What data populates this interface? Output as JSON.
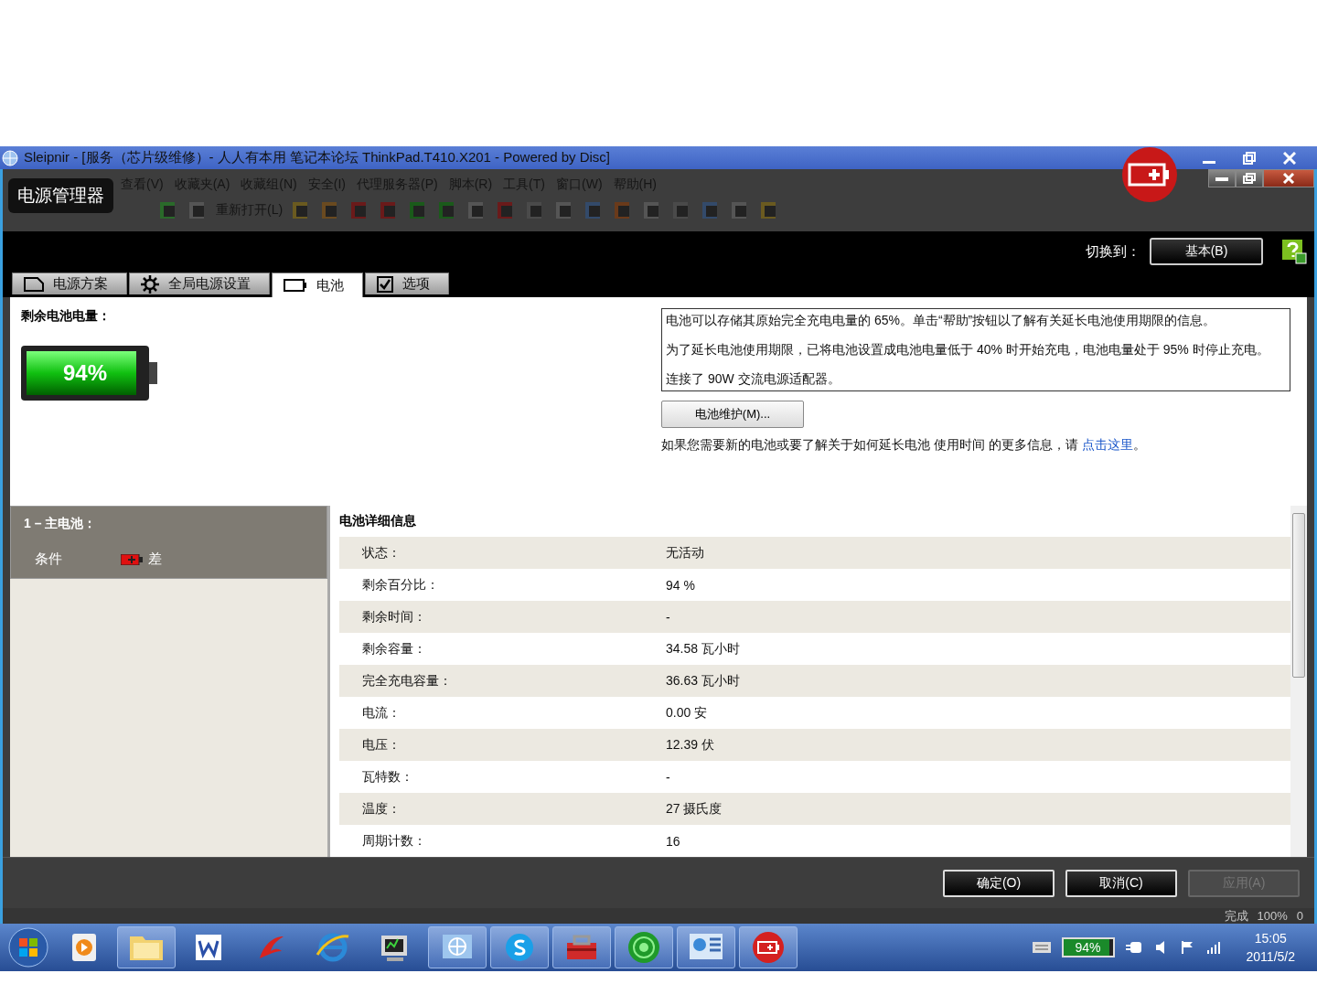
{
  "browser": {
    "title": "Sleipnir - [服务（芯片级维修）- 人人有本用 笔记本论坛 ThinkPad.T410.X201 - Powered by Disc]",
    "menu": [
      "查看(V)",
      "收藏夹(A)",
      "收藏组(N)",
      "安全(I)",
      "代理服务器(P)",
      "脚本(R)",
      "工具(T)",
      "窗口(W)",
      "帮助(H)"
    ],
    "reopen": "重新打开(L)",
    "status": {
      "text": "完成",
      "zoom": "100%",
      "errors": "0"
    }
  },
  "dialog": {
    "title": "电源管理器",
    "switch_label": "切换到：",
    "mode_button": "基本(B)",
    "tabs": [
      {
        "label": "电源方案",
        "kind": "page",
        "selected": false
      },
      {
        "label": "全局电源设置",
        "kind": "gear",
        "selected": false
      },
      {
        "label": "电池",
        "kind": "battery",
        "selected": true
      },
      {
        "label": "选项",
        "kind": "check",
        "selected": false
      }
    ],
    "remaining_label": "剩余电池电量：",
    "battery": {
      "text": "94%",
      "level": 0.94
    },
    "info": [
      "电池可以存储其原始完全充电电量的 65%。单击“帮助”按钮以了解有关延长电池使用期限的信息。",
      "为了延长电池使用期限，已将电池设置成电池电量低于 40% 时开始充电，电池电量处于 95% 时停止充电。",
      "连接了 90W 交流电源适配器。"
    ],
    "maintenance_button": "电池维护(M)...",
    "more_info": {
      "text": "如果您需要新的电池或要了解关于如何延长电池 使用时间 的更多信息，请 ",
      "link": "点击这里",
      "end": "。"
    },
    "battery_list": {
      "header": "1 – 主电池：",
      "condition_label": "条件",
      "condition_value": "差"
    },
    "details": {
      "title": "电池详细信息",
      "rows": [
        {
          "label": "状态：",
          "value": "无活动"
        },
        {
          "label": "剩余百分比：",
          "value": "94 %"
        },
        {
          "label": "剩余时间：",
          "value": "-"
        },
        {
          "label": "剩余容量：",
          "value": "34.58 瓦小时"
        },
        {
          "label": "完全充电容量：",
          "value": "36.63 瓦小时"
        },
        {
          "label": "电流：",
          "value": "0.00 安"
        },
        {
          "label": "电压：",
          "value": "12.39 伏"
        },
        {
          "label": "瓦特数：",
          "value": "-"
        },
        {
          "label": "温度：",
          "value": "27 摄氏度"
        },
        {
          "label": "周期计数：",
          "value": "16"
        }
      ]
    },
    "buttons": [
      {
        "label": "确定(O)",
        "disabled": false
      },
      {
        "label": "取消(C)",
        "disabled": false
      },
      {
        "label": "应用(A)",
        "disabled": true
      }
    ]
  },
  "taskbar": {
    "apps": [
      {
        "kind": "play",
        "running": false
      },
      {
        "kind": "folder",
        "running": true
      },
      {
        "kind": "document",
        "running": false
      },
      {
        "kind": "swirl",
        "running": false
      },
      {
        "kind": "globe",
        "running": false
      },
      {
        "kind": "monitor",
        "running": false
      },
      {
        "kind": "network",
        "running": true
      },
      {
        "kind": "chat",
        "running": true
      },
      {
        "kind": "toolbox",
        "running": true
      },
      {
        "kind": "circle",
        "running": true
      },
      {
        "kind": "panel",
        "running": true
      },
      {
        "kind": "battery",
        "running": true
      }
    ],
    "battery": {
      "text": "94%",
      "level": 0.94
    },
    "time": "15:05",
    "date": "2011/5/2"
  }
}
